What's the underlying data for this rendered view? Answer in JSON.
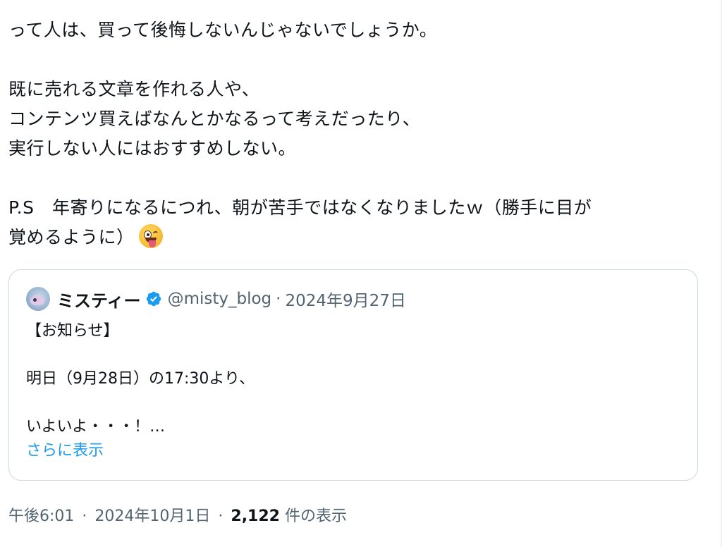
{
  "tweet": {
    "lines": [
      "って人は、買って後悔しないんじゃないでしょうか。",
      "",
      "既に売れる文章を作れる人や、",
      "コンテンツ買えばなんとかなるって考えだったり、",
      "実行しない人にはおすすめしない。",
      "",
      "P.S　年寄りになるにつれ、朝が苦手ではなくなりましたｗ（勝手に目が",
      "覚めるように）"
    ],
    "emoji": "zany-face-emoji"
  },
  "quote": {
    "author_name": "ミスティー",
    "handle": "@misty_blog",
    "separator": "·",
    "date": "2024年9月27日",
    "body_lines": [
      "【お知らせ】",
      "",
      "明日（9月28日）の17:30より、",
      "",
      "いよいよ・・・！…"
    ],
    "show_more": "さらに表示"
  },
  "meta": {
    "time": "午後6:01",
    "separator": "·",
    "date": "2024年10月1日",
    "views_count": "2,122",
    "views_label": "件の表示"
  },
  "colors": {
    "text": "#0f1419",
    "secondary": "#536471",
    "accent": "#1d9bf0",
    "border": "#cfd9de"
  }
}
